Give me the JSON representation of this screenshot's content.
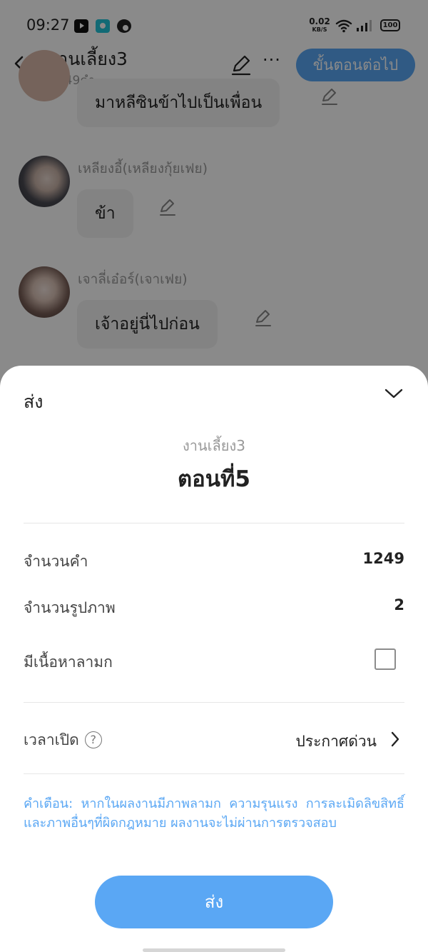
{
  "status_bar": {
    "time": "09:27",
    "net_speed": "0.02",
    "net_unit": "KB/S",
    "battery": "100"
  },
  "header": {
    "title": "งานเลี้ยง3",
    "word_count": "1249คำ",
    "next_label": "ขั้นตอนต่อไป"
  },
  "messages": [
    {
      "text": "มาหลีซินข้าไปเป็นเพื่อน"
    },
    {
      "speaker": "เหลียงอี้(เหลียงกุ้ยเฟย)",
      "text": "ข้า"
    },
    {
      "speaker": "เจาลี่เอ๋อร์(เจาเฟย)",
      "text": "เจ้าอยู่นี่ไปก่อน"
    }
  ],
  "sheet": {
    "title": "ส่ง",
    "subtitle": "งานเลี้ยง3",
    "chapter": "ตอนที่5",
    "rows": {
      "word_count_label": "จำนวนคำ",
      "word_count_value": "1249",
      "image_count_label": "จำนวนรูปภาพ",
      "image_count_value": "2",
      "adult_label": "มีเนื้อหาลามก",
      "adult_checked": false,
      "open_time_label": "เวลาเปิด",
      "open_time_help": "?",
      "open_time_value": "ประกาศด่วน"
    },
    "warning": "คำเตือน: หากในผลงานมีภาพลามก ความรุนแรง การละเมิดลิขสิทธิ์และภาพอื่นๆที่ผิดกฎหมาย ผลงานจะไม่ผ่านการตรวจสอบ",
    "send_label": "ส่ง"
  },
  "colors": {
    "accent": "#5aa7f4",
    "overlay": "rgba(0,0,0,0.46)"
  }
}
